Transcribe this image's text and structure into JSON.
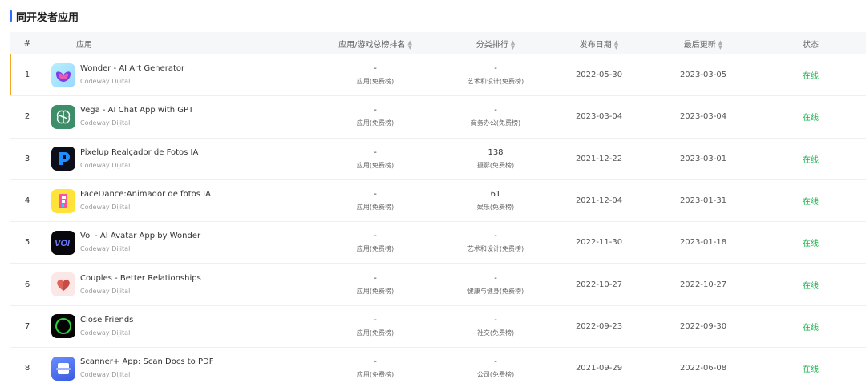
{
  "title": "同开发者应用",
  "columns": {
    "index": "#",
    "app": "应用",
    "total_rank": "应用/游戏总榜排名",
    "category_rank": "分类排行",
    "release_date": "发布日期",
    "last_update": "最后更新",
    "status": "状态"
  },
  "rows": [
    {
      "index": "1",
      "name": "Wonder - AI Art Generator",
      "developer": "Codeway Dijital",
      "total_rank": "-",
      "total_label": "应用(免费榜)",
      "cat_rank": "-",
      "cat_label": "艺术和设计(免费榜)",
      "release": "2022-05-30",
      "update": "2023-03-05",
      "status": "在线",
      "icon": "wonder-icon"
    },
    {
      "index": "2",
      "name": "Vega - AI Chat App with GPT",
      "developer": "Codeway Dijital",
      "total_rank": "-",
      "total_label": "应用(免费榜)",
      "cat_rank": "-",
      "cat_label": "商务办公(免费榜)",
      "release": "2023-03-04",
      "update": "2023-03-04",
      "status": "在线",
      "icon": "vega-brain-icon"
    },
    {
      "index": "3",
      "name": "Pixelup Realçador de Fotos IA",
      "developer": "Codeway Dijital",
      "total_rank": "-",
      "total_label": "应用(免费榜)",
      "cat_rank": "138",
      "cat_label": "摄影(免费榜)",
      "release": "2021-12-22",
      "update": "2023-03-01",
      "status": "在线",
      "icon": "pixelup-icon"
    },
    {
      "index": "4",
      "name": "FaceDance:Animador de fotos IA",
      "developer": "Codeway Dijital",
      "total_rank": "-",
      "total_label": "应用(免费榜)",
      "cat_rank": "61",
      "cat_label": "娱乐(免费榜)",
      "release": "2021-12-04",
      "update": "2023-01-31",
      "status": "在线",
      "icon": "facedance-icon"
    },
    {
      "index": "5",
      "name": "Voi - AI Avatar App by Wonder",
      "developer": "Codeway Dijital",
      "total_rank": "-",
      "total_label": "应用(免费榜)",
      "cat_rank": "-",
      "cat_label": "艺术和设计(免费榜)",
      "release": "2022-11-30",
      "update": "2023-01-18",
      "status": "在线",
      "icon": "voi-icon"
    },
    {
      "index": "6",
      "name": "Couples - Better Relationships",
      "developer": "Codeway Dijital",
      "total_rank": "-",
      "total_label": "应用(免费榜)",
      "cat_rank": "-",
      "cat_label": "健康与健身(免费榜)",
      "release": "2022-10-27",
      "update": "2022-10-27",
      "status": "在线",
      "icon": "couples-heart-icon"
    },
    {
      "index": "7",
      "name": "Close Friends",
      "developer": "Codeway Dijital",
      "total_rank": "-",
      "total_label": "应用(免费榜)",
      "cat_rank": "-",
      "cat_label": "社交(免费榜)",
      "release": "2022-09-23",
      "update": "2022-09-30",
      "status": "在线",
      "icon": "close-friends-ring-icon"
    },
    {
      "index": "8",
      "name": "Scanner+ App: Scan Docs to PDF",
      "developer": "Codeway Dijital",
      "total_rank": "-",
      "total_label": "应用(免费榜)",
      "cat_rank": "-",
      "cat_label": "公司(免费榜)",
      "release": "2021-09-29",
      "update": "2022-06-08",
      "status": "在线",
      "icon": "scanner-icon"
    }
  ],
  "colors": {
    "accent": "#2f6bff",
    "status_online": "#19b24a",
    "active_row_marker": "#f5a623"
  }
}
